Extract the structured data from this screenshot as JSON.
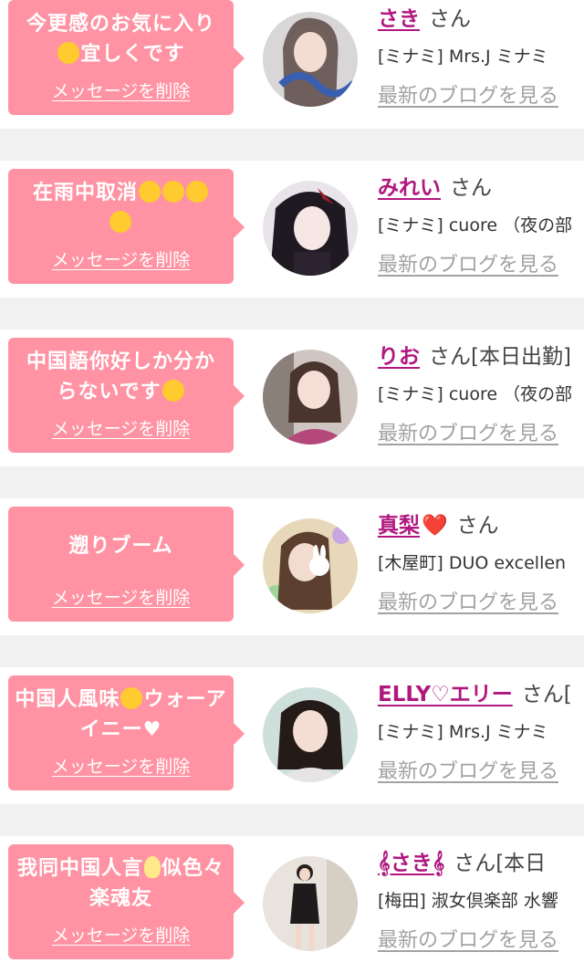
{
  "cards": [
    {
      "message_before": "今更感のお気に入り",
      "message_emoji": "rolling-laugh-emoji",
      "message_after": "宜しくです",
      "delete_label": "メッセージを削除",
      "name": "さき",
      "honorific": "さん",
      "shop": "[ミナミ] Mrs.J ミナミ",
      "blog_label": "最新のブログを見る"
    },
    {
      "message_before": "在雨中取消",
      "message_emoji": "weary-crying-emoji",
      "message_after": "",
      "delete_label": "メッセージを削除",
      "name": "みれい",
      "honorific": "さん",
      "shop": "[ミナミ] cuore （夜の部",
      "blog_label": "最新のブログを見る"
    },
    {
      "message_before": "中国語你好しか分か",
      "message_emoji": "rolling-laugh-emoji",
      "message_after": "らないです",
      "delete_label": "メッセージを削除",
      "name": "りお",
      "honorific": "さん[本日出勤]",
      "shop": "[ミナミ] cuore （夜の部",
      "blog_label": "最新のブログを見る"
    },
    {
      "message_before": "遡りブーム",
      "message_emoji": "",
      "message_after": "",
      "delete_label": "メッセージを削除",
      "name": "真梨",
      "name_suffix": "❤️",
      "honorific": "さん",
      "shop": "[木屋町] DUO excellen",
      "blog_label": "最新のブログを見る"
    },
    {
      "message_before": "中国人風味",
      "message_emoji": "grinning-squint-emoji",
      "message_after": "ウォーアイニー♥",
      "delete_label": "メッセージを削除",
      "name": "ELLY♡エリー",
      "honorific": "さん[",
      "shop": "[ミナミ] Mrs.J ミナミ",
      "blog_label": "最新のブログを見る"
    },
    {
      "message_before": "我同中国人言",
      "message_emoji": "light-bulb-emoji",
      "message_after": "似色々楽魂友",
      "delete_label": "メッセージを削除",
      "name": "𝄞さき𝄞",
      "honorific": "さん[本日",
      "shop": "[梅田] 淑女倶楽部 水響",
      "blog_label": "最新のブログを見る"
    }
  ],
  "colors": {
    "bubble": "#ff93a3",
    "name": "#b0177f",
    "blog_link": "#a2a2a2",
    "page_bg": "#f1f1f1"
  }
}
